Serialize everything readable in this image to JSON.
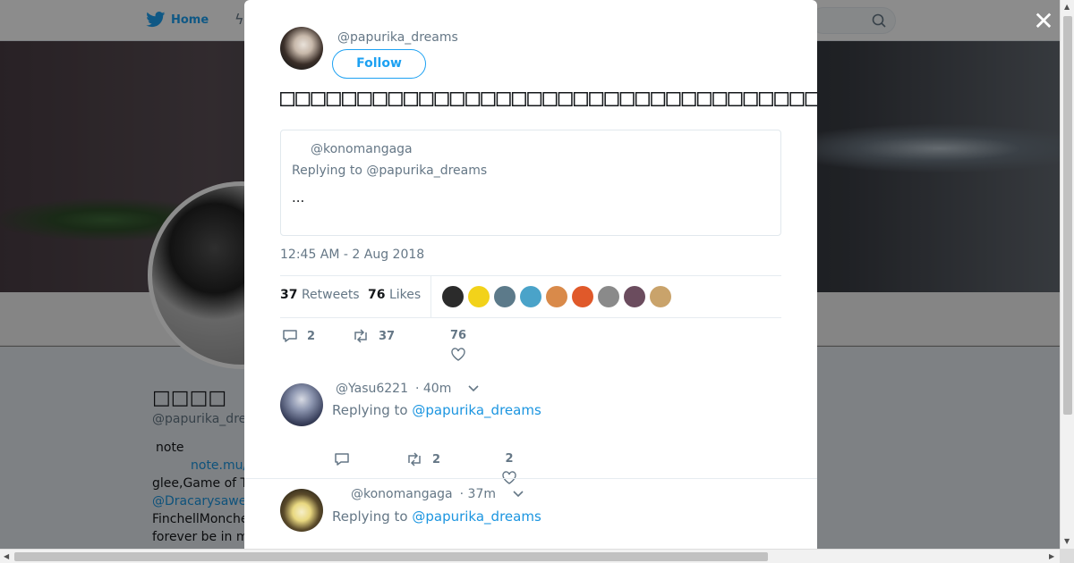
{
  "nav": {
    "home_label": "Home",
    "accent": "#1da1f2"
  },
  "background_profile": {
    "name": "□□□□",
    "handle": "@papurika_dre",
    "bio_line1": "note",
    "bio_link": "note.mu/",
    "bio_line2": "glee,Game of T",
    "bio_mention": "@Dracarysawe",
    "bio_line3": "FinchellMonche",
    "bio_line4": "forever be in m"
  },
  "modal": {
    "close_label": "✕",
    "author_handle": "@papurika_dreams",
    "follow_label": "Follow",
    "tweet_text": "□□□□□□□□□□□□□□□□□□□□□□□□□□□□□□□□□□□□□□□□□□□□□",
    "quote": {
      "handle": "@konomangaga",
      "replying": "Replying to @papurika_dreams",
      "body": "..."
    },
    "timestamp": "12:45 AM - 2 Aug 2018",
    "retweets_count": "37",
    "retweets_label": "Retweets",
    "likes_count": "76",
    "likes_label": "Likes",
    "likers": [
      "#2b2b2b",
      "#f2d21a",
      "#5c7a8a",
      "#4aa3c9",
      "#d98a4a",
      "#e0592a",
      "#8a8a8a",
      "#6b4c5e",
      "#c9a36b"
    ],
    "actions": {
      "reply_count": "2",
      "retweet_count": "37",
      "like_count": "76"
    }
  },
  "replies": [
    {
      "handle": "@Yasu6221",
      "time": "· 40m",
      "replying_prefix": "Replying to",
      "replying_link": "@papurika_dreams",
      "reply_count": "",
      "retweet_count": "2",
      "like_count": "2"
    },
    {
      "handle": "@konomangaga",
      "time": "· 37m",
      "replying_prefix": "Replying to",
      "replying_link": "@papurika_dreams"
    }
  ]
}
